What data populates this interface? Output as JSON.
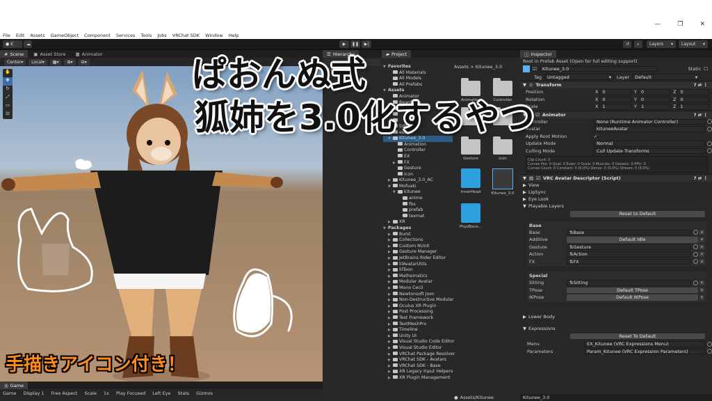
{
  "menu": [
    "File",
    "Edit",
    "Assets",
    "GameObject",
    "Component",
    "Services",
    "Tools",
    "Jobs",
    "VRChat SDK",
    "Window",
    "Help"
  ],
  "toolbar": {
    "account": "K",
    "layers": "Layers",
    "layout": "Layout"
  },
  "scene": {
    "tabs": [
      "Scene",
      "Asset Store",
      "Animator"
    ],
    "pivot": "Center",
    "space": "Local"
  },
  "hierarchy": {
    "tab": "Hierarchy",
    "items": [
      "3.0",
      "",
      ""
    ]
  },
  "project": {
    "tab": "Project",
    "tree": [
      {
        "t": "Favorites",
        "i": 0,
        "caret": "▼",
        "head": true
      },
      {
        "t": "All Materials",
        "i": 1
      },
      {
        "t": "All Models",
        "i": 1
      },
      {
        "t": "All Prefabs",
        "i": 1
      },
      {
        "t": "Assets",
        "i": 0,
        "caret": "▼",
        "head": true
      },
      {
        "t": "Animator",
        "i": 1
      },
      {
        "t": "BeardGen",
        "i": 1
      },
      {
        "t": "",
        "i": 1
      },
      {
        "t": "",
        "i": 1
      },
      {
        "t": "",
        "i": 1
      },
      {
        "t": "Editor",
        "i": 1
      },
      {
        "t": "ession",
        "i": 1
      },
      {
        "t": "Kitunee_3.0",
        "i": 1,
        "caret": "▼",
        "sel": true
      },
      {
        "t": "Animation",
        "i": 2
      },
      {
        "t": "Controller",
        "i": 2
      },
      {
        "t": "EX",
        "i": 2
      },
      {
        "t": "FX",
        "i": 2,
        "caret": "▶"
      },
      {
        "t": "Gesture",
        "i": 2
      },
      {
        "t": "icon",
        "i": 2
      },
      {
        "t": "Kitunee_3.0_AC",
        "i": 1,
        "caret": "▶"
      },
      {
        "t": "Mofuaki",
        "i": 1,
        "caret": "▼"
      },
      {
        "t": "kitunee",
        "i": 2,
        "caret": "▼"
      },
      {
        "t": "anime",
        "i": 3
      },
      {
        "t": "fbx",
        "i": 3
      },
      {
        "t": "prefab",
        "i": 3
      },
      {
        "t": "texmat",
        "i": 3
      },
      {
        "t": "XR",
        "i": 1,
        "caret": "▶"
      },
      {
        "t": "Packages",
        "i": 0,
        "caret": "▼",
        "head": true
      },
      {
        "t": "Burst",
        "i": 1,
        "caret": "▶"
      },
      {
        "t": "Collections",
        "i": 1,
        "caret": "▶"
      },
      {
        "t": "Custom NUnit",
        "i": 1,
        "caret": "▶"
      },
      {
        "t": "Gesture Manager",
        "i": 1,
        "caret": "▶"
      },
      {
        "t": "JetBrains Rider Editor",
        "i": 1,
        "caret": "▶"
      },
      {
        "t": "lilAvatarUtils",
        "i": 1,
        "caret": "▶"
      },
      {
        "t": "lilToon",
        "i": 1,
        "caret": "▶"
      },
      {
        "t": "Mathematics",
        "i": 1,
        "caret": "▶"
      },
      {
        "t": "Modular Avatar",
        "i": 1,
        "caret": "▶"
      },
      {
        "t": "Mono Cecil",
        "i": 1,
        "caret": "▶"
      },
      {
        "t": "Newtonsoft Json",
        "i": 1,
        "caret": "▶"
      },
      {
        "t": "Non-Destructive Modular",
        "i": 1,
        "caret": "▶"
      },
      {
        "t": "Oculus XR Plugin",
        "i": 1,
        "caret": "▶"
      },
      {
        "t": "Post Processing",
        "i": 1,
        "caret": "▶"
      },
      {
        "t": "Test Framework",
        "i": 1,
        "caret": "▶"
      },
      {
        "t": "TextMeshPro",
        "i": 1,
        "caret": "▶"
      },
      {
        "t": "Timeline",
        "i": 1,
        "caret": "▶"
      },
      {
        "t": "Unity UI",
        "i": 1,
        "caret": "▶"
      },
      {
        "t": "Visual Studio Code Editor",
        "i": 1,
        "caret": "▶"
      },
      {
        "t": "Visual Studio Editor",
        "i": 1,
        "caret": "▶"
      },
      {
        "t": "VRChat Package Resolver",
        "i": 1,
        "caret": "▶"
      },
      {
        "t": "VRChat SDK - Avatars",
        "i": 1,
        "caret": "▶"
      },
      {
        "t": "VRChat SDK - Base",
        "i": 1,
        "caret": "▶"
      },
      {
        "t": "XR Legacy Input Helpers",
        "i": 1,
        "caret": "▶"
      },
      {
        "t": "XR Plugin Management",
        "i": 1,
        "caret": "▶"
      }
    ],
    "breadcrumb": "Assets > Kitunee_3.0",
    "count": "25",
    "grid": [
      {
        "name": "Animation",
        "kind": "folder"
      },
      {
        "name": "Controller",
        "kind": "folder"
      },
      {
        "name": "",
        "kind": "folder"
      },
      {
        "name": "",
        "kind": "folder"
      },
      {
        "name": "Gesture",
        "kind": "folder"
      },
      {
        "name": "icon",
        "kind": "folder"
      },
      {
        "name": "InnerHead",
        "kind": "cube"
      },
      {
        "name": "Kitunee_3.0",
        "kind": "prefab"
      },
      {
        "name": "PhysBone...",
        "kind": "cube"
      }
    ],
    "footer": "Assets/Kitunee"
  },
  "inspector": {
    "tab": "Inspector",
    "notice": "Root in Prefab Asset (Open for full editing support)",
    "name": "Kitunee_3.0",
    "static": "Static",
    "tag_label": "Tag",
    "tag": "Untagged",
    "layer_label": "Layer",
    "layer": "Default",
    "transform": {
      "title": "Transform",
      "rows": [
        {
          "label": "Position",
          "x": "0",
          "y": "0",
          "z": "0"
        },
        {
          "label": "Rotation",
          "x": "0",
          "y": "0",
          "z": "0"
        },
        {
          "label": "Scale",
          "x": "1",
          "y": "1",
          "z": "1"
        }
      ]
    },
    "animator": {
      "title": "Animator",
      "rows": [
        {
          "k": "Controller",
          "v": "None (Runtime Animator Controller)"
        },
        {
          "k": "Avatar",
          "v": "kituneeAvatar"
        },
        {
          "k": "Apply Root Motion",
          "v": "✓"
        },
        {
          "k": "Update Mode",
          "v": "Normal"
        },
        {
          "k": "Culling Mode",
          "v": "Cull Update Transforms"
        }
      ],
      "info": [
        "Clip Count: 0",
        "Curves Pos: 0 Quat: 0 Euler: 0 Scale: 0 Muscles: 0 Generic: 0 PPtr: 0",
        "Curves Count: 0 Constant: 0 (0.0%) Dense: 0 (0.0%) Stream: 0 (0.0%)"
      ]
    },
    "vrc": {
      "title": "VRC Avatar Descriptor (Script)",
      "sections": [
        "View",
        "LipSync",
        "Eye Look",
        "Playable Layers"
      ],
      "reset": "Reset to Default",
      "base_title": "Base",
      "base": [
        {
          "k": "Base",
          "v": "Base",
          "btn": false
        },
        {
          "k": "Additive",
          "v": "Default Idle",
          "btn": true
        },
        {
          "k": "Gesture",
          "v": "Gesture",
          "btn": false
        },
        {
          "k": "Action",
          "v": "Action",
          "btn": false
        },
        {
          "k": "FX",
          "v": "FX",
          "btn": false
        }
      ],
      "special_title": "Special",
      "special": [
        {
          "k": "Sitting",
          "v": "Sitting",
          "btn": false
        },
        {
          "k": "TPose",
          "v": "Default TPose",
          "btn": true
        },
        {
          "k": "IKPose",
          "v": "Default IKPose",
          "btn": true
        }
      ],
      "lower_body": "Lower Body",
      "expressions": "Expressions",
      "reset2": "Reset To Default",
      "menu_label": "Menu",
      "menu": "EX_Kitunee (VRC Expressions Menu)",
      "params_label": "Parameters",
      "params": "Param_Kitunee (VRC Expression Parameters)"
    },
    "footer": "Kitunee_3.0"
  },
  "game": {
    "tab": "Game",
    "items": [
      "Game",
      "Display 1",
      "Free Aspect",
      "Scale",
      "1x",
      "Play Focused",
      "Left Eye",
      "Stats",
      "Gizmos"
    ]
  },
  "overlay": {
    "line1": "ぱおんぬ式",
    "line2": "狐姉を3.0化するやつ",
    "badge": "手描きアイコン付き！"
  }
}
